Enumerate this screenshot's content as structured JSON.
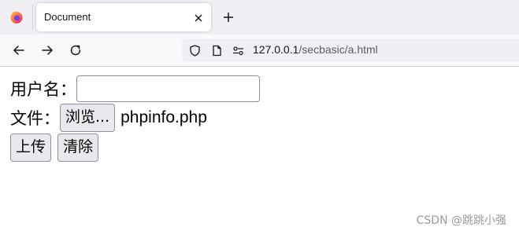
{
  "browser": {
    "tab": {
      "title": "Document"
    },
    "address": {
      "host": "127.0.0.1",
      "path": "/secbasic/a.html"
    }
  },
  "form": {
    "username_label": "用户名：",
    "username_value": "",
    "file_label": "文件：",
    "browse_label": "浏览...",
    "file_name": "phpinfo.php",
    "upload_label": "上传",
    "clear_label": "清除"
  },
  "watermark": "CSDN @跳跳小强",
  "icons": {
    "browser_logo": "firefox-icon",
    "tab_close": "close-icon",
    "new_tab": "plus-icon",
    "back": "arrow-left-icon",
    "forward": "arrow-right-icon",
    "reload": "reload-icon",
    "security": "shield-icon",
    "page": "page-icon",
    "permissions": "permissions-icon"
  },
  "colors": {
    "chrome_bg": "#f0f0f4",
    "nav_bg": "#f9f9fb",
    "button_bg": "#e9e9ed",
    "firefox_orange": "#ff7139"
  }
}
